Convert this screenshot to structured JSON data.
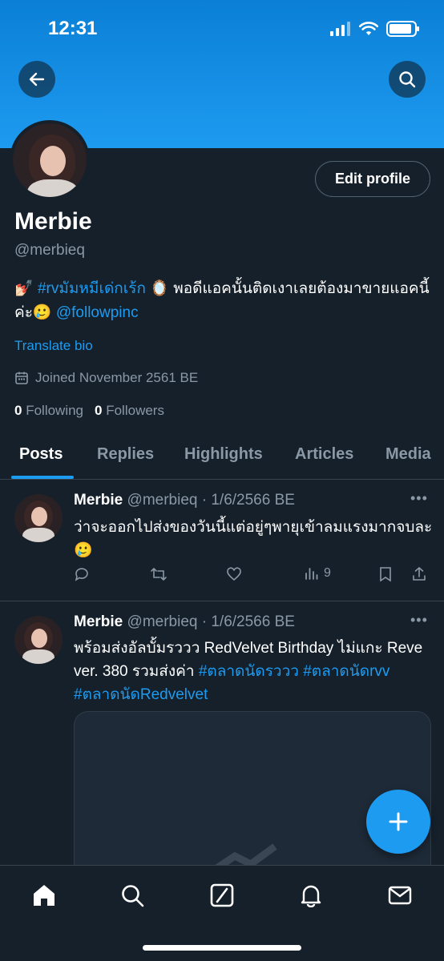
{
  "status_bar": {
    "time": "12:31"
  },
  "profile": {
    "display_name": "Merbie",
    "handle": "@merbieq",
    "edit_profile_label": "Edit profile",
    "bio_emoji_left": "💅🏻",
    "bio_hashtag": "#rvมัมหมีเด่กเร้ก",
    "bio_emoji_mirror": "🪞",
    "bio_text": "พอดีแอคนั้นติดเงาเลยต้องมาขายแอคนี้ค่ะ🥲",
    "bio_mention": "@followpinc",
    "translate_bio": "Translate bio",
    "joined": "Joined November 2561 BE",
    "following_count": "0",
    "following_label": "Following",
    "followers_count": "0",
    "followers_label": "Followers"
  },
  "tabs": [
    {
      "label": "Posts",
      "active": true
    },
    {
      "label": "Replies",
      "active": false
    },
    {
      "label": "Highlights",
      "active": false
    },
    {
      "label": "Articles",
      "active": false
    },
    {
      "label": "Media",
      "active": false
    }
  ],
  "tweets": [
    {
      "name": "Merbie",
      "meta": "@merbieq · 1/6/2566 BE",
      "text": "ว่าจะออกไปส่งของวันนี้แต่อยู่ๆพายุเข้าลมแรงมากจบละ🥲",
      "views": "9"
    },
    {
      "name": "Merbie",
      "meta": "@merbieq · 1/6/2566 BE",
      "text_plain": "พร้อมส่งอัลบั้มรววว RedVelvet Birthday ไม่แกะ Reve ver. 380 รวมส่งค่า ",
      "hashtags": "#ตลาดนัดรววว #ตลาดนัดrvv #ตลาดนัดRedvelvet"
    }
  ],
  "icons": {
    "back": "arrow-left-icon",
    "search": "search-icon",
    "calendar": "calendar-icon",
    "reply": "reply-icon",
    "retweet": "retweet-icon",
    "like": "heart-icon",
    "views": "views-icon",
    "bookmark": "bookmark-icon",
    "share": "share-icon",
    "compose": "plus-icon"
  },
  "colors": {
    "accent": "#1d9bf0",
    "background": "#15202b",
    "muted": "#8b98a5"
  }
}
